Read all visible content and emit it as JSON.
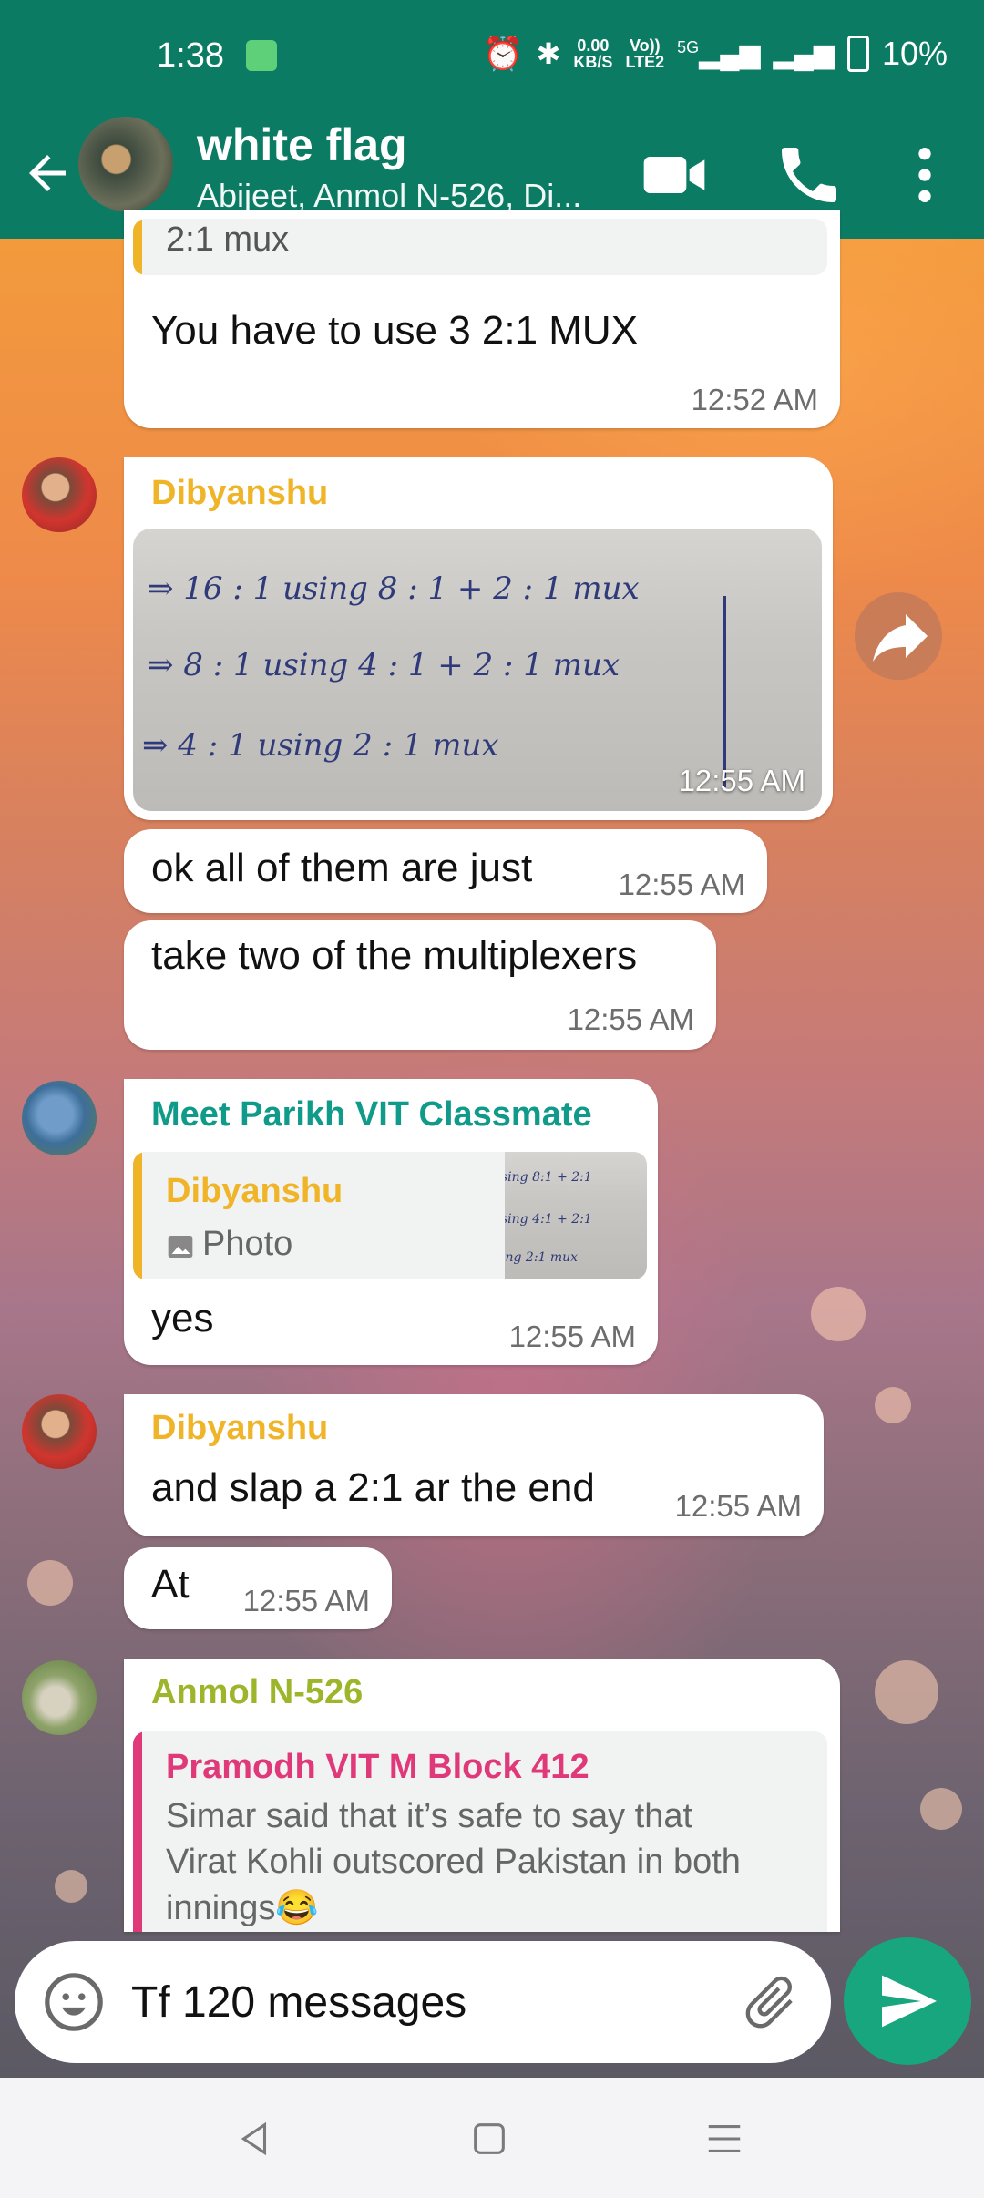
{
  "status_bar": {
    "time": "1:38",
    "net_speed_top": "0.00",
    "net_speed_bottom": "KB/S",
    "volte_top": "Vo))",
    "volte_bottom": "LTE2",
    "network": "5G",
    "battery": "10%"
  },
  "header": {
    "title": "white flag",
    "subtitle": "Abijeet, Anmol N-526, Di..."
  },
  "messages": {
    "m1": {
      "quote_text": "2:1 mux",
      "text": "You have to use 3 2:1 MUX",
      "time": "12:52 AM"
    },
    "m2": {
      "sender": "Dibyanshu",
      "photo_lines": [
        "⇒ 16 : 1    using    8 : 1 + 2 : 1    mux",
        "⇒ 8 : 1    using    4 : 1 + 2 : 1    mux",
        "⇒ 4 : 1    using    2 : 1    mux"
      ],
      "time": "12:55 AM"
    },
    "m3": {
      "text": "ok all of them are just",
      "time": "12:55 AM"
    },
    "m4": {
      "text": "take two of the multiplexers",
      "time": "12:55 AM"
    },
    "m5": {
      "sender": "Meet Parikh VIT Classmate",
      "quote_sender": "Dibyanshu",
      "quote_text": "Photo",
      "text": "yes",
      "time": "12:55 AM"
    },
    "m6": {
      "sender": "Dibyanshu",
      "text": "and slap a 2:1 ar the end",
      "time": "12:55 AM"
    },
    "m7": {
      "text": "At",
      "time": "12:55 AM"
    },
    "m8": {
      "sender": "Anmol N-526",
      "quote_sender": "Pramodh VIT M Block 412",
      "quote_line1": "Simar said that it’s safe to say that",
      "quote_line2": "Virat Kohli outscored Pakistan in both",
      "quote_line3": "innings😂"
    }
  },
  "composer": {
    "value": "Tf 120 messages"
  },
  "colors": {
    "brand": "#0b7b63",
    "send": "#18a67e",
    "sender_dibyanshu": "#f0b429",
    "sender_meet": "#0f9a8a",
    "sender_anmol": "#9db52a",
    "sender_pramodh": "#e0397a"
  },
  "icons": {
    "back": "arrow-left-icon",
    "video": "video-call-icon",
    "call": "phone-icon",
    "menu": "more-vert-icon",
    "forward": "forward-icon",
    "emoji": "emoji-icon",
    "attach": "attach-icon",
    "send": "send-icon",
    "photo": "photo-icon"
  }
}
